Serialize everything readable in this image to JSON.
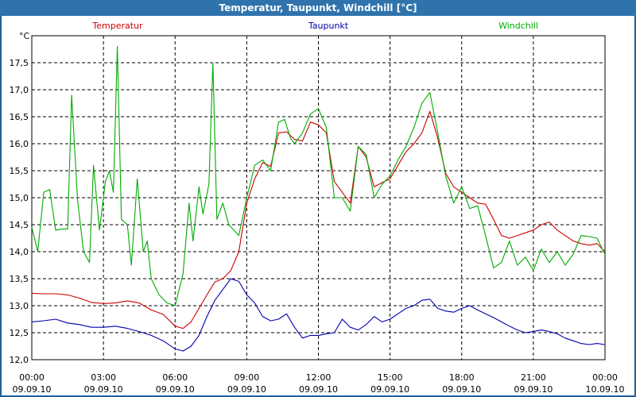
{
  "window": {
    "title": "Temperatur, Taupunkt, Windchill [°C]"
  },
  "chart_data": {
    "type": "line",
    "title": "Temperatur, Taupunkt, Windchill [°C]",
    "ylabel": "°C",
    "ylim": [
      12.0,
      18.0
    ],
    "xlim": [
      "09.09.10 00:00",
      "10.09.10 00:00"
    ],
    "grid": true,
    "legend_placement": "top",
    "y_ticks": [
      "12,0",
      "12,5",
      "13,0",
      "13,5",
      "14,0",
      "14,5",
      "15,0",
      "15,5",
      "16,0",
      "16,5",
      "17,0",
      "17,5"
    ],
    "x_ticks": [
      {
        "time": "00:00",
        "date": "09.09.10"
      },
      {
        "time": "03:00",
        "date": "09.09.10"
      },
      {
        "time": "06:00",
        "date": "09.09.10"
      },
      {
        "time": "09:00",
        "date": "09.09.10"
      },
      {
        "time": "12:00",
        "date": "09.09.10"
      },
      {
        "time": "15:00",
        "date": "09.09.10"
      },
      {
        "time": "18:00",
        "date": "09.09.10"
      },
      {
        "time": "21:00",
        "date": "09.09.10"
      },
      {
        "time": "00:00",
        "date": "10.09.10"
      }
    ],
    "series": [
      {
        "name": "Temperatur",
        "color": "#cc0000",
        "points": [
          [
            "00:00",
            13.23
          ],
          [
            "00:30",
            13.22
          ],
          [
            "01:00",
            13.22
          ],
          [
            "01:30",
            13.2
          ],
          [
            "02:00",
            13.14
          ],
          [
            "02:30",
            13.06
          ],
          [
            "03:00",
            13.04
          ],
          [
            "03:30",
            13.05
          ],
          [
            "04:00",
            13.09
          ],
          [
            "04:30",
            13.05
          ],
          [
            "05:00",
            12.92
          ],
          [
            "05:30",
            12.84
          ],
          [
            "06:00",
            12.62
          ],
          [
            "06:20",
            12.58
          ],
          [
            "06:40",
            12.7
          ],
          [
            "07:00",
            12.95
          ],
          [
            "07:20",
            13.2
          ],
          [
            "07:40",
            13.44
          ],
          [
            "08:00",
            13.5
          ],
          [
            "08:20",
            13.65
          ],
          [
            "08:40",
            14.0
          ],
          [
            "09:00",
            14.9
          ],
          [
            "09:20",
            15.35
          ],
          [
            "09:40",
            15.65
          ],
          [
            "10:00",
            15.58
          ],
          [
            "10:20",
            16.2
          ],
          [
            "10:40",
            16.22
          ],
          [
            "11:00",
            16.08
          ],
          [
            "11:20",
            16.05
          ],
          [
            "11:40",
            16.4
          ],
          [
            "12:00",
            16.35
          ],
          [
            "12:20",
            16.2
          ],
          [
            "12:40",
            15.3
          ],
          [
            "13:00",
            15.1
          ],
          [
            "13:20",
            14.9
          ],
          [
            "13:40",
            15.95
          ],
          [
            "14:00",
            15.75
          ],
          [
            "14:20",
            15.2
          ],
          [
            "14:40",
            15.28
          ],
          [
            "15:00",
            15.35
          ],
          [
            "15:20",
            15.6
          ],
          [
            "15:40",
            15.85
          ],
          [
            "16:00",
            16.0
          ],
          [
            "16:20",
            16.2
          ],
          [
            "16:40",
            16.6
          ],
          [
            "17:00",
            16.1
          ],
          [
            "17:20",
            15.45
          ],
          [
            "17:40",
            15.2
          ],
          [
            "18:00",
            15.1
          ],
          [
            "18:20",
            15.0
          ],
          [
            "18:40",
            14.9
          ],
          [
            "19:00",
            14.88
          ],
          [
            "19:20",
            14.6
          ],
          [
            "19:40",
            14.3
          ],
          [
            "20:00",
            14.25
          ],
          [
            "20:20",
            14.3
          ],
          [
            "20:40",
            14.35
          ],
          [
            "21:00",
            14.4
          ],
          [
            "21:20",
            14.5
          ],
          [
            "21:40",
            14.55
          ],
          [
            "22:00",
            14.4
          ],
          [
            "22:20",
            14.3
          ],
          [
            "22:40",
            14.2
          ],
          [
            "23:00",
            14.15
          ],
          [
            "23:20",
            14.12
          ],
          [
            "23:40",
            14.15
          ],
          [
            "24:00",
            14.0
          ]
        ]
      },
      {
        "name": "Taupunkt",
        "color": "#0000aa",
        "points": [
          [
            "00:00",
            12.7
          ],
          [
            "00:30",
            12.72
          ],
          [
            "01:00",
            12.75
          ],
          [
            "01:30",
            12.68
          ],
          [
            "02:00",
            12.65
          ],
          [
            "02:30",
            12.6
          ],
          [
            "03:00",
            12.6
          ],
          [
            "03:30",
            12.62
          ],
          [
            "04:00",
            12.58
          ],
          [
            "04:30",
            12.52
          ],
          [
            "05:00",
            12.45
          ],
          [
            "05:30",
            12.35
          ],
          [
            "06:00",
            12.2
          ],
          [
            "06:20",
            12.16
          ],
          [
            "06:40",
            12.25
          ],
          [
            "07:00",
            12.45
          ],
          [
            "07:20",
            12.8
          ],
          [
            "07:40",
            13.1
          ],
          [
            "08:00",
            13.3
          ],
          [
            "08:20",
            13.5
          ],
          [
            "08:40",
            13.45
          ],
          [
            "09:00",
            13.2
          ],
          [
            "09:20",
            13.05
          ],
          [
            "09:40",
            12.8
          ],
          [
            "10:00",
            12.72
          ],
          [
            "10:20",
            12.75
          ],
          [
            "10:40",
            12.85
          ],
          [
            "11:00",
            12.6
          ],
          [
            "11:20",
            12.4
          ],
          [
            "11:40",
            12.45
          ],
          [
            "12:00",
            12.45
          ],
          [
            "12:20",
            12.48
          ],
          [
            "12:40",
            12.5
          ],
          [
            "13:00",
            12.75
          ],
          [
            "13:20",
            12.6
          ],
          [
            "13:40",
            12.55
          ],
          [
            "14:00",
            12.65
          ],
          [
            "14:20",
            12.8
          ],
          [
            "14:40",
            12.7
          ],
          [
            "15:00",
            12.75
          ],
          [
            "15:20",
            12.85
          ],
          [
            "15:40",
            12.95
          ],
          [
            "16:00",
            13.0
          ],
          [
            "16:20",
            13.1
          ],
          [
            "16:40",
            13.12
          ],
          [
            "17:00",
            12.95
          ],
          [
            "17:20",
            12.9
          ],
          [
            "17:40",
            12.88
          ],
          [
            "18:00",
            12.95
          ],
          [
            "18:20",
            13.0
          ],
          [
            "18:40",
            12.92
          ],
          [
            "19:00",
            12.85
          ],
          [
            "19:20",
            12.78
          ],
          [
            "19:40",
            12.7
          ],
          [
            "20:00",
            12.62
          ],
          [
            "20:20",
            12.55
          ],
          [
            "20:40",
            12.5
          ],
          [
            "21:00",
            12.52
          ],
          [
            "21:20",
            12.55
          ],
          [
            "21:40",
            12.52
          ],
          [
            "22:00",
            12.48
          ],
          [
            "22:20",
            12.4
          ],
          [
            "22:40",
            12.35
          ],
          [
            "23:00",
            12.3
          ],
          [
            "23:20",
            12.28
          ],
          [
            "23:40",
            12.3
          ],
          [
            "24:00",
            12.28
          ]
        ]
      },
      {
        "name": "Windchill",
        "color": "#00aa00",
        "points": [
          [
            "00:00",
            14.45
          ],
          [
            "00:15",
            14.0
          ],
          [
            "00:30",
            15.1
          ],
          [
            "00:45",
            15.15
          ],
          [
            "01:00",
            14.4
          ],
          [
            "01:15",
            14.42
          ],
          [
            "01:30",
            14.42
          ],
          [
            "01:40",
            16.9
          ],
          [
            "01:55",
            14.95
          ],
          [
            "02:10",
            14.0
          ],
          [
            "02:25",
            13.8
          ],
          [
            "02:35",
            15.6
          ],
          [
            "02:50",
            14.4
          ],
          [
            "03:05",
            15.3
          ],
          [
            "03:15",
            15.5
          ],
          [
            "03:25",
            15.1
          ],
          [
            "03:35",
            17.8
          ],
          [
            "03:45",
            14.6
          ],
          [
            "04:00",
            14.5
          ],
          [
            "04:10",
            13.75
          ],
          [
            "04:25",
            15.35
          ],
          [
            "04:40",
            14.0
          ],
          [
            "04:50",
            14.2
          ],
          [
            "05:00",
            13.5
          ],
          [
            "05:20",
            13.2
          ],
          [
            "05:40",
            13.05
          ],
          [
            "06:00",
            13.0
          ],
          [
            "06:20",
            13.6
          ],
          [
            "06:35",
            14.9
          ],
          [
            "06:45",
            14.2
          ],
          [
            "07:00",
            15.2
          ],
          [
            "07:10",
            14.7
          ],
          [
            "07:25",
            15.25
          ],
          [
            "07:35",
            17.5
          ],
          [
            "07:45",
            14.6
          ],
          [
            "08:00",
            14.9
          ],
          [
            "08:15",
            14.5
          ],
          [
            "08:40",
            14.3
          ],
          [
            "09:00",
            15.0
          ],
          [
            "09:20",
            15.6
          ],
          [
            "09:40",
            15.7
          ],
          [
            "10:00",
            15.5
          ],
          [
            "10:20",
            16.4
          ],
          [
            "10:35",
            16.45
          ],
          [
            "10:50",
            16.1
          ],
          [
            "11:00",
            16.0
          ],
          [
            "11:20",
            16.2
          ],
          [
            "11:40",
            16.55
          ],
          [
            "12:00",
            16.65
          ],
          [
            "12:20",
            16.3
          ],
          [
            "12:40",
            15.0
          ],
          [
            "13:00",
            15.0
          ],
          [
            "13:20",
            14.75
          ],
          [
            "13:40",
            15.95
          ],
          [
            "14:00",
            15.8
          ],
          [
            "14:20",
            15.0
          ],
          [
            "14:40",
            15.25
          ],
          [
            "15:00",
            15.4
          ],
          [
            "15:20",
            15.7
          ],
          [
            "15:40",
            15.95
          ],
          [
            "16:00",
            16.3
          ],
          [
            "16:20",
            16.75
          ],
          [
            "16:40",
            16.95
          ],
          [
            "17:00",
            16.2
          ],
          [
            "17:20",
            15.4
          ],
          [
            "17:40",
            14.9
          ],
          [
            "18:00",
            15.2
          ],
          [
            "18:20",
            14.8
          ],
          [
            "18:40",
            14.85
          ],
          [
            "19:00",
            14.3
          ],
          [
            "19:20",
            13.7
          ],
          [
            "19:40",
            13.8
          ],
          [
            "20:00",
            14.2
          ],
          [
            "20:20",
            13.75
          ],
          [
            "20:40",
            13.9
          ],
          [
            "21:00",
            13.65
          ],
          [
            "21:20",
            14.05
          ],
          [
            "21:40",
            13.8
          ],
          [
            "22:00",
            14.0
          ],
          [
            "22:20",
            13.75
          ],
          [
            "22:40",
            13.95
          ],
          [
            "23:00",
            14.3
          ],
          [
            "23:20",
            14.28
          ],
          [
            "23:40",
            14.25
          ],
          [
            "24:00",
            13.95
          ]
        ]
      }
    ]
  }
}
